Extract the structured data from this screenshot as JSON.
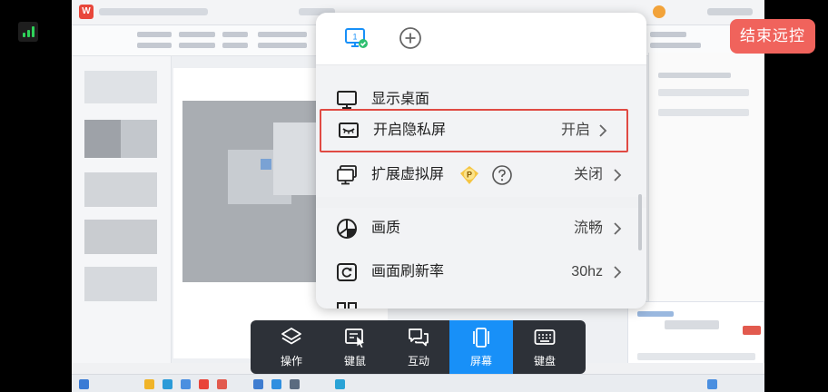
{
  "remote": {
    "app_logo": "W"
  },
  "overlay": {
    "end_remote_label": "结束远控"
  },
  "menu": {
    "top_icons": [
      "monitor-1-icon",
      "add-circle-icon"
    ],
    "monitor_number": "1",
    "items": [
      {
        "label": "显示桌面",
        "value": "",
        "icon": "desktop-icon",
        "highlighted": false,
        "has_chevron": false
      },
      {
        "label": "开启隐私屏",
        "value": "开启",
        "icon": "privacy-eye-closed-icon",
        "highlighted": true,
        "has_chevron": true
      },
      {
        "label": "扩展虚拟屏",
        "value": "关闭",
        "icon": "virtual-screen-icon",
        "highlighted": false,
        "has_chevron": true,
        "badge": "P"
      },
      {
        "label": "画质",
        "value": "流畅",
        "icon": "quality-icon",
        "highlighted": false,
        "has_chevron": true
      },
      {
        "label": "画面刷新率",
        "value": "30hz",
        "icon": "refresh-icon",
        "highlighted": false,
        "has_chevron": true
      }
    ]
  },
  "toolbar": {
    "items": [
      {
        "label": "操作",
        "icon": "layers-icon",
        "active": false
      },
      {
        "label": "键鼠",
        "icon": "keyboard-mouse-icon",
        "active": false
      },
      {
        "label": "互动",
        "icon": "chat-icon",
        "active": false
      },
      {
        "label": "屏幕",
        "icon": "screen-icon",
        "active": true
      },
      {
        "label": "键盘",
        "icon": "keyboard-icon",
        "active": false
      }
    ]
  },
  "colors": {
    "accent": "#1890f8",
    "end_button": "#f0635c",
    "highlight_border": "#e04a43",
    "signal": "#2fd35a",
    "badge_gold": "#f5c542"
  }
}
